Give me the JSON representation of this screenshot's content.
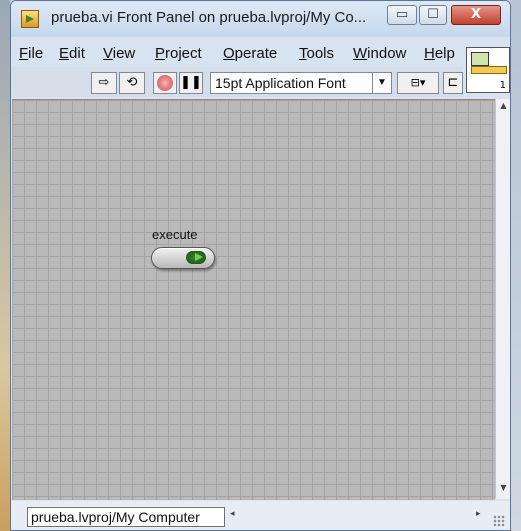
{
  "window": {
    "title": "prueba.vi Front Panel on prueba.lvproj/My Co...",
    "min_glyph": "▭",
    "max_glyph": "☐",
    "close_glyph": "X"
  },
  "menu": {
    "items": [
      {
        "accel": "F",
        "rest": "ile"
      },
      {
        "accel": "E",
        "rest": "dit"
      },
      {
        "accel": "V",
        "rest": "iew"
      },
      {
        "accel": "P",
        "rest": "roject"
      },
      {
        "accel": "O",
        "rest": "perate"
      },
      {
        "accel": "T",
        "rest": "ools"
      },
      {
        "accel": "W",
        "rest": "indow"
      },
      {
        "accel": "H",
        "rest": "elp"
      }
    ]
  },
  "toolbar": {
    "run_glyph": "⇨",
    "run_continuously_glyph": "⟲",
    "pause_glyph": "❚❚",
    "font_value": "15pt Application Font",
    "combo_arrow": "▼",
    "align_glyph": "⊟▾",
    "distribute_glyph": "⊏"
  },
  "vi_icon": {
    "number": "1"
  },
  "panel": {
    "control_label": "execute",
    "button_color": "#2e6b22"
  },
  "scroll": {
    "up": "▲",
    "down": "▼",
    "left": "◂",
    "right": "▸"
  },
  "status": {
    "context": "prueba.lvproj/My Computer"
  }
}
